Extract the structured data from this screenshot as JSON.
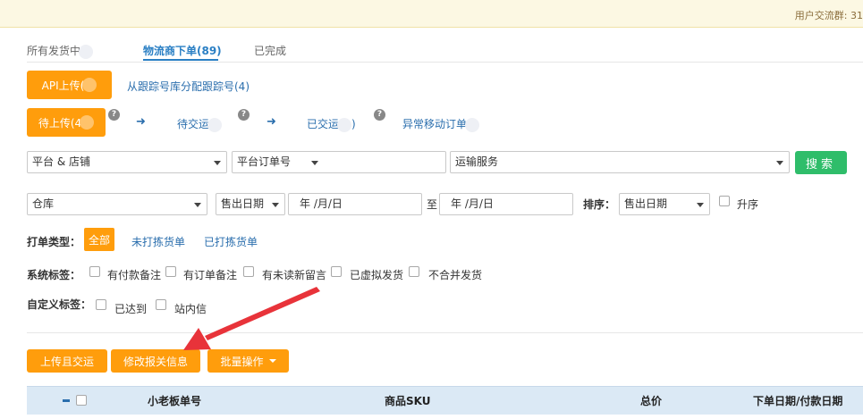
{
  "notice": {
    "text": "用户交流群: 31"
  },
  "tabs": [
    {
      "label": "所有发货中"
    },
    {
      "label": "物流商下单(89)"
    },
    {
      "label": "已完成"
    }
  ],
  "upload": {
    "api_button": "API上传(",
    "assign_link": "从跟踪号库分配跟踪号(4)"
  },
  "steps": {
    "pending_button": "待上传(4",
    "step2": "待交运",
    "step3": "已交运",
    "step3_suffix": ")",
    "step4": "异常移动订单",
    "help_glyph": "?",
    "arrow_glyph": "➜"
  },
  "filters": {
    "platform_store": "平台 & 店铺",
    "platform_order": "平台订单号",
    "shipping_service": "运输服务",
    "search_button": "搜索",
    "warehouse": "仓库",
    "date_type": "售出日期",
    "date_from": "年 /月/日",
    "to_label": "至",
    "date_to": "年 /月/日",
    "sort_label": "排序：",
    "sort_value": "售出日期",
    "ascending_label": "升序"
  },
  "print_type": {
    "label": "打单类型：",
    "options": [
      "全部",
      "未打拣货单",
      "已打拣货单"
    ]
  },
  "system_tags": {
    "label": "系统标签：",
    "options": [
      "有付款备注",
      "有订单备注",
      "有未读新留言",
      "已虚拟发货",
      "不合并发货"
    ]
  },
  "custom_tags": {
    "label": "自定义标签：",
    "options": [
      "已达到",
      "站内信"
    ]
  },
  "actions": {
    "upload_ship": "上传且交运",
    "edit_customs": "修改报关信息",
    "bulk": "批量操作"
  },
  "table": {
    "headers": [
      "小老板单号",
      "商品SKU",
      "总价",
      "下单日期/付款日期"
    ]
  },
  "colors": {
    "accent_orange": "#ff9d0c",
    "search_green": "#2fbd6a",
    "link_blue": "#2a6ead",
    "annotation_red": "#e8333a"
  }
}
